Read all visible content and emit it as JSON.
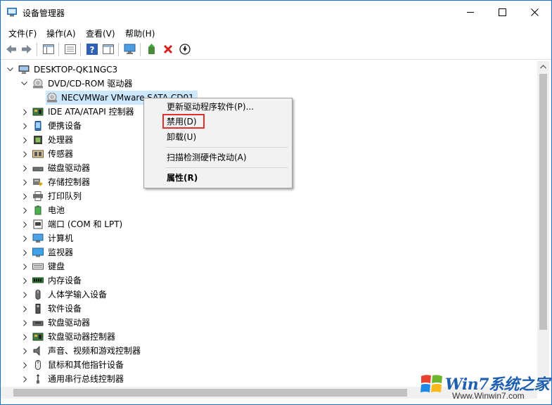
{
  "window": {
    "title": "设备管理器"
  },
  "menu": [
    "文件(F)",
    "操作(A)",
    "查看(V)",
    "帮助(H)"
  ],
  "tree": {
    "root": "DESKTOP-QK1NGC3",
    "dvd_category": "DVD/CD-ROM 驱动器",
    "dvd_device": "NECVMWar VMware SATA CD01",
    "categories": [
      {
        "label": "IDE ATA/ATAPI 控制器",
        "icon": "ide-icon"
      },
      {
        "label": "便携设备",
        "icon": "portable-icon"
      },
      {
        "label": "处理器",
        "icon": "processor-icon"
      },
      {
        "label": "传感器",
        "icon": "sensor-icon"
      },
      {
        "label": "磁盘驱动器",
        "icon": "disk-icon"
      },
      {
        "label": "存储控制器",
        "icon": "storage-icon"
      },
      {
        "label": "打印队列",
        "icon": "printer-icon"
      },
      {
        "label": "电池",
        "icon": "battery-icon"
      },
      {
        "label": "端口 (COM 和 LPT)",
        "icon": "port-icon"
      },
      {
        "label": "计算机",
        "icon": "computer-icon"
      },
      {
        "label": "监视器",
        "icon": "monitor-icon"
      },
      {
        "label": "键盘",
        "icon": "keyboard-icon"
      },
      {
        "label": "内存设备",
        "icon": "memory-icon"
      },
      {
        "label": "人体学输入设备",
        "icon": "hid-icon"
      },
      {
        "label": "软件设备",
        "icon": "software-icon"
      },
      {
        "label": "软盘驱动器",
        "icon": "floppy-icon"
      },
      {
        "label": "软盘驱动器控制器",
        "icon": "floppy-controller-icon"
      },
      {
        "label": "声音、视频和游戏控制器",
        "icon": "sound-icon"
      },
      {
        "label": "鼠标和其他指针设备",
        "icon": "mouse-icon"
      },
      {
        "label": "通用串行总线控制器",
        "icon": "usb-icon"
      }
    ]
  },
  "context_menu": {
    "update_driver": "更新驱动程序软件(P)...",
    "disable": "禁用(D)",
    "uninstall": "卸载(U)",
    "scan": "扫描检测硬件改动(A)",
    "properties": "属性(R)"
  },
  "watermark": {
    "brand": "Win7系统之家",
    "url": "Www.Winwin7.com"
  },
  "colors": {
    "selection": "#cce8ff",
    "highlight_box": "#e0312e",
    "window_border": "#1a73c9"
  }
}
